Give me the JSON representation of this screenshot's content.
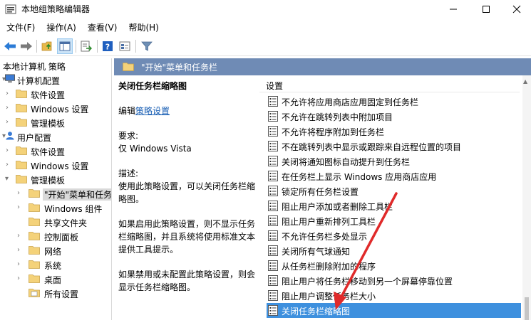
{
  "window": {
    "title": "本地组策略编辑器",
    "controls": [
      "minimize",
      "maximize",
      "close"
    ]
  },
  "menu": [
    "文件(F)",
    "操作(A)",
    "查看(V)",
    "帮助(H)"
  ],
  "toolbar": [
    "back-arrow-icon",
    "forward-arrow-icon",
    "up-folder-icon",
    "show-hide-tree-icon",
    "export-list-icon",
    "help-icon",
    "properties-icon",
    "filter-icon"
  ],
  "tree": {
    "root": "本地计算机 策略",
    "computer_config": "计算机配置",
    "cc_software": "软件设置",
    "cc_windows": "Windows 设置",
    "cc_admin": "管理模板",
    "user_config": "用户配置",
    "uc_software": "软件设置",
    "uc_windows": "Windows 设置",
    "uc_admin": "管理模板",
    "at_start": "\"开始\"菜单和任务栏",
    "at_windows_comp": "Windows 组件",
    "at_shared": "共享文件夹",
    "at_control": "控制面板",
    "at_network": "网络",
    "at_system": "系统",
    "at_desktop": "桌面",
    "at_all": "所有设置"
  },
  "header": {
    "title": "\"开始\"菜单和任务栏"
  },
  "description": {
    "title": "关闭任务栏缩略图",
    "edit_prefix": "编辑",
    "edit_link": "策略设置",
    "req_label": "要求:",
    "req_value": "仅 Windows Vista",
    "desc_label": "描述:",
    "desc_line1": "使用此策略设置，可以关闭任务栏缩",
    "desc_line2": "略图。",
    "enable_line1": "如果启用此策略设置，则不显示任务",
    "enable_line2": "栏缩略图，并且系统将使用标准文本",
    "enable_line3": "提供工具提示。",
    "disable_line1": "如果禁用或未配置此策略设置，则会",
    "disable_line2": "显示任务栏缩略图。"
  },
  "list": {
    "header": "设置",
    "items": [
      "不允许将应用商店应用固定到任务栏",
      "不允许在跳转列表中附加项目",
      "不允许将程序附加到任务栏",
      "不在跳转列表中显示或跟踪来自远程位置的项目",
      "关闭将通知图标自动提升到任务栏",
      "在任务栏上显示 Windows 应用商店应用",
      "锁定所有任务栏设置",
      "阻止用户添加或者删除工具栏",
      "阻止用户重新排列工具栏",
      "不允许任务栏多处显示",
      "关闭所有气球通知",
      "从任务栏删除附加的程序",
      "阻止用户将任务栏移动到另一个屏幕停靠位置",
      "阻止用户调整任务栏大小",
      "关闭任务栏缩略图"
    ],
    "selected_index": 14
  },
  "colors": {
    "header_bar": "#6f8bb5",
    "selection": "#3e90de",
    "annotation_arrow": "#e02a2a"
  }
}
